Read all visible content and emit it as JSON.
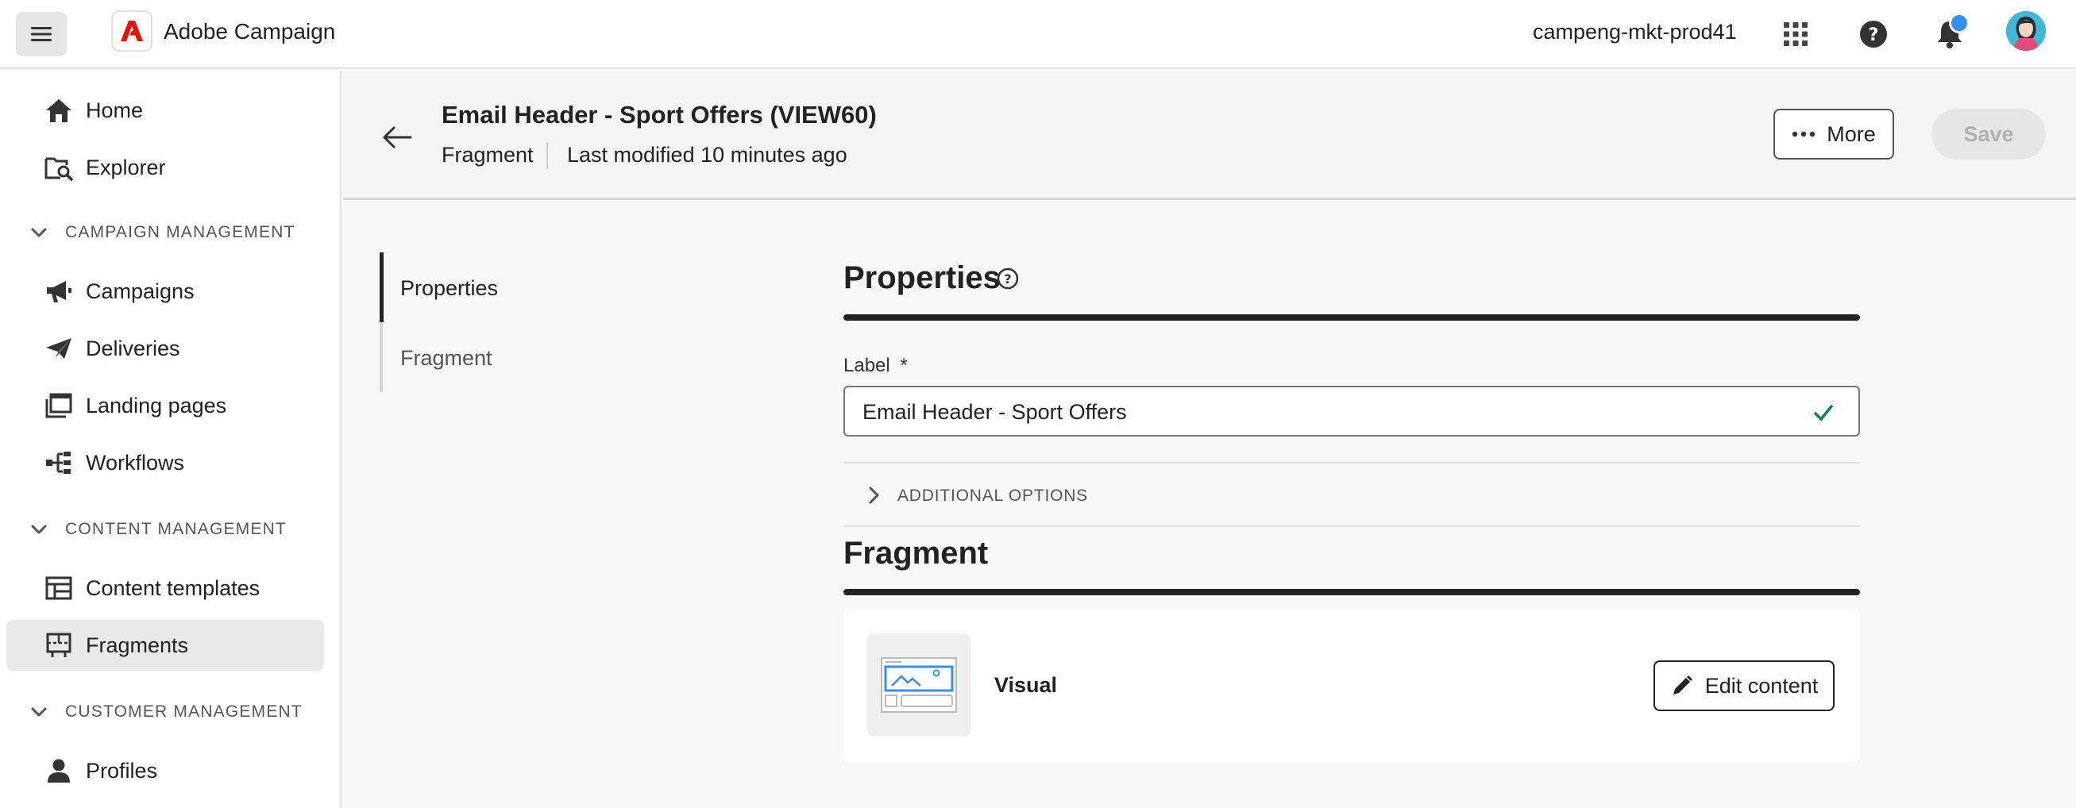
{
  "app": {
    "title": "Adobe Campaign",
    "org": "campeng-mkt-prod41",
    "brand_color": "#eb1000",
    "notification_color": "#378ef0"
  },
  "topbar": {
    "menu_icon": "hamburger-menu-icon",
    "logo_icon": "adobe-logo-icon",
    "apps_icon": "app-switcher-icon",
    "help_icon": "help-icon",
    "notifications_icon": "bell-icon",
    "profile_icon": "avatar"
  },
  "sidebar": {
    "items": [
      {
        "label": "Home",
        "icon": "home-icon"
      },
      {
        "label": "Explorer",
        "icon": "explorer-icon"
      }
    ],
    "sections": [
      {
        "title": "CAMPAIGN MANAGEMENT",
        "items": [
          {
            "label": "Campaigns",
            "icon": "megaphone-icon"
          },
          {
            "label": "Deliveries",
            "icon": "paper-plane-icon"
          },
          {
            "label": "Landing pages",
            "icon": "landing-pages-icon"
          },
          {
            "label": "Workflows",
            "icon": "workflow-icon"
          }
        ]
      },
      {
        "title": "CONTENT MANAGEMENT",
        "items": [
          {
            "label": "Content templates",
            "icon": "templates-icon"
          },
          {
            "label": "Fragments",
            "icon": "fragments-icon",
            "active": true
          }
        ]
      },
      {
        "title": "CUSTOMER MANAGEMENT",
        "items": [
          {
            "label": "Profiles",
            "icon": "profile-user-icon"
          }
        ]
      }
    ]
  },
  "header": {
    "title": "Email Header - Sport Offers (VIEW60)",
    "type": "Fragment",
    "modified": "Last modified 10 minutes ago",
    "more_label": "More",
    "save_label": "Save"
  },
  "inner_nav": {
    "items": [
      {
        "label": "Properties",
        "active": true
      },
      {
        "label": "Fragment",
        "active": false
      }
    ]
  },
  "properties": {
    "heading": "Properties",
    "label_field": {
      "label": "Label",
      "required_marker": "*",
      "value": "Email Header - Sport Offers",
      "valid": true
    },
    "additional_options": "ADDITIONAL OPTIONS"
  },
  "fragment": {
    "heading": "Fragment",
    "type_label": "Visual",
    "edit_label": "Edit content"
  },
  "colors": {
    "valid_check": "#12805c",
    "thumbnail_accent": "#378ef0"
  }
}
